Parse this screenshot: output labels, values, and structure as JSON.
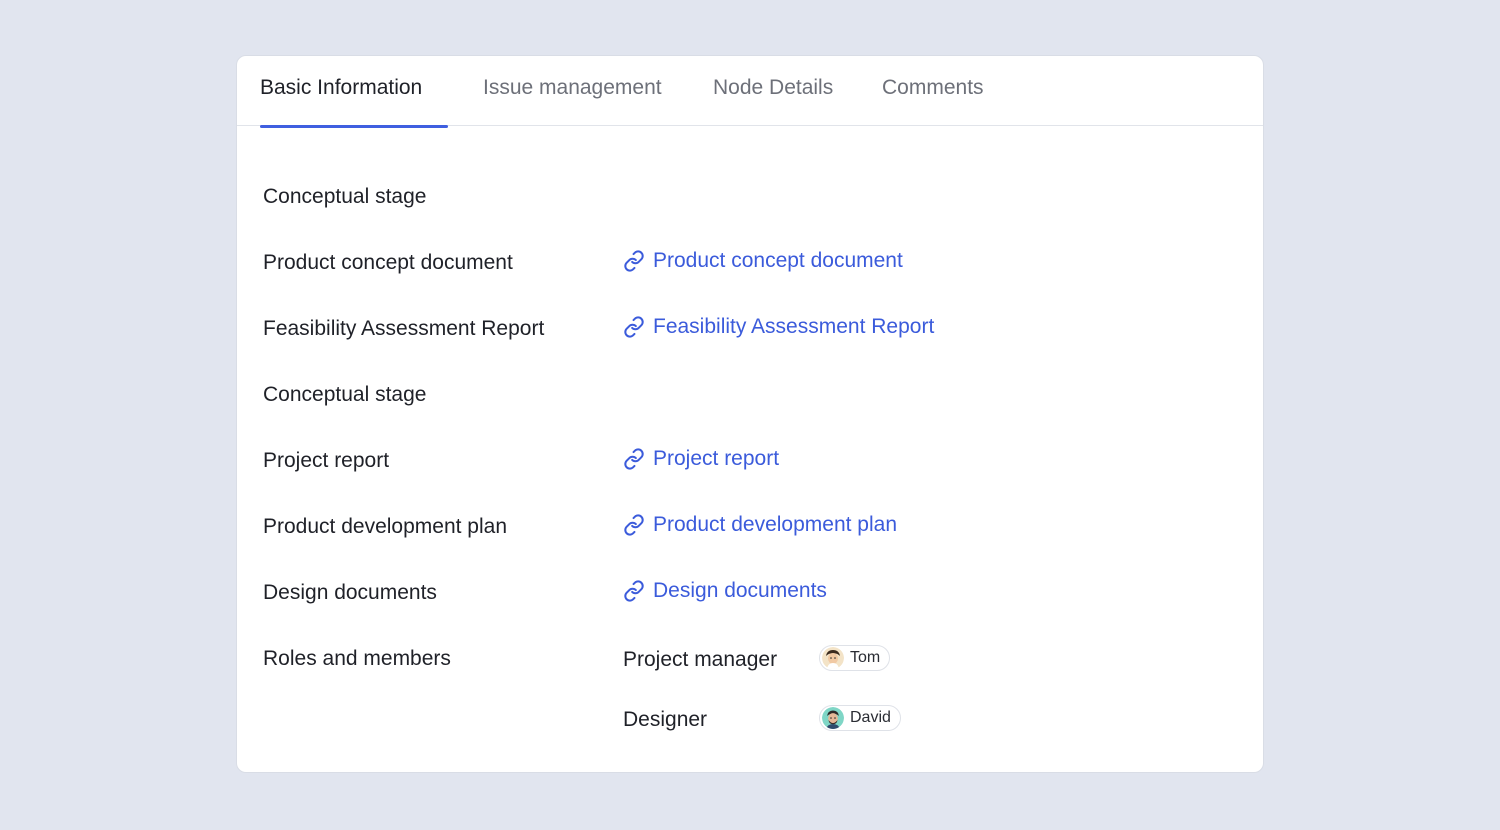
{
  "tabs": [
    {
      "label": "Basic Information",
      "active": true
    },
    {
      "label": "Issue management",
      "active": false
    },
    {
      "label": "Node Details",
      "active": false
    },
    {
      "label": "Comments",
      "active": false
    }
  ],
  "rows": [
    {
      "label": "Conceptual stage"
    },
    {
      "label": "Product concept document",
      "link": "Product concept document"
    },
    {
      "label": "Feasibility Assessment Report",
      "link": "Feasibility Assessment Report"
    },
    {
      "label": "Conceptual stage"
    },
    {
      "label": "Project report",
      "link": "Project report"
    },
    {
      "label": "Product development plan",
      "link": "Product development plan"
    },
    {
      "label": "Design documents",
      "link": "Design documents"
    },
    {
      "label": "Roles and members"
    }
  ],
  "roles": [
    {
      "role": "Project manager",
      "member": "Tom",
      "avatar_icon": "avatar-tom-icon"
    },
    {
      "role": "Designer",
      "member": "David",
      "avatar_icon": "avatar-david-icon"
    }
  ],
  "colors": {
    "accent": "#3f5fe0",
    "link": "#3b5bdb",
    "background": "#e1e5ef"
  }
}
